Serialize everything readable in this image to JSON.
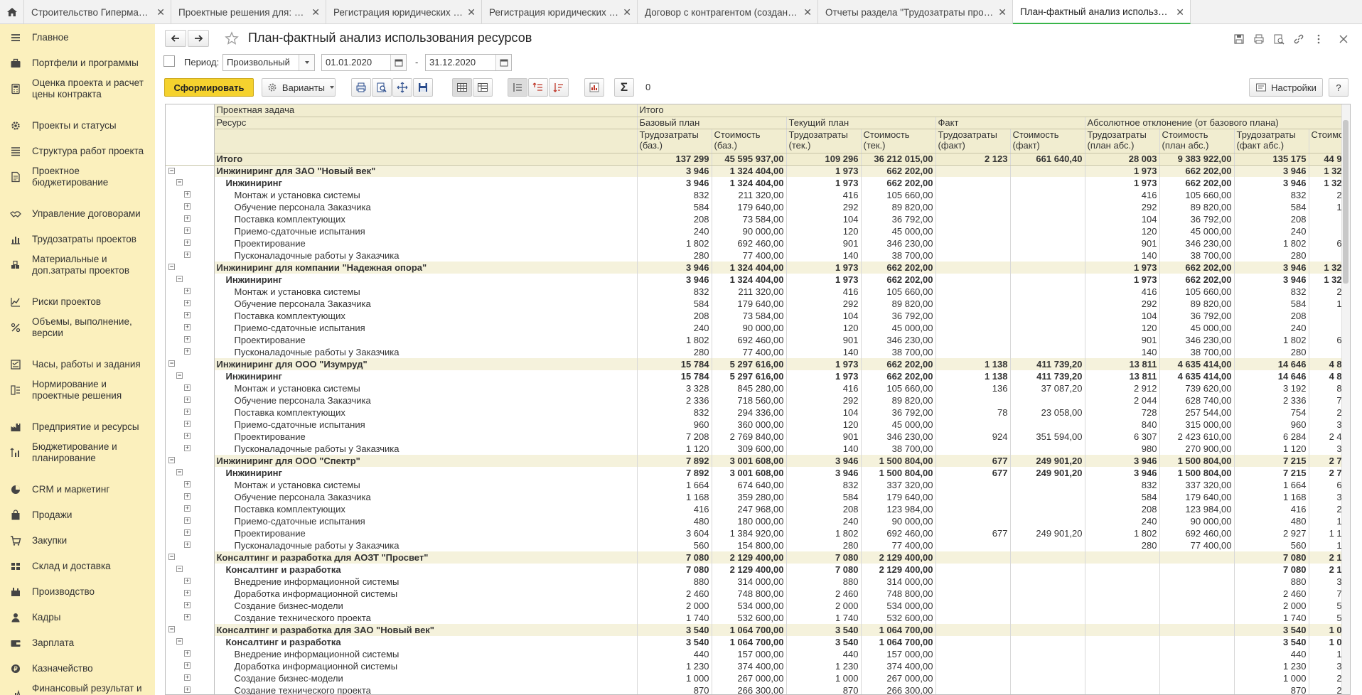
{
  "colors": {
    "sidebar": "#fbf0bd",
    "accent_yellow": "#f5d22e",
    "active_tab": "#39b54a",
    "header_bg": "#f1edd0"
  },
  "tabs": [
    {
      "label": "Строительство Гипермаркета (Проект)",
      "active": false
    },
    {
      "label": "Проектные решения для: Строительство Гипермаркета",
      "active": false
    },
    {
      "label": "Регистрация юридических условий договора",
      "active": false
    },
    {
      "label": "Регистрация юридических условий договора",
      "active": false
    },
    {
      "label": "Договор с контрагентом (создание) *",
      "active": false
    },
    {
      "label": "Отчеты раздела \"Трудозатраты проектов\"",
      "active": false
    },
    {
      "label": "План-фактный анализ использования ресурсов",
      "active": true
    }
  ],
  "sidebar": [
    {
      "label": "Главное",
      "icon": "menu-icon"
    },
    {
      "label": "Портфели и программы",
      "icon": "briefcase-icon"
    },
    {
      "label": "Оценка проекта и расчет цены контракта",
      "icon": "calculator-icon"
    },
    {
      "label": "Проекты и статусы",
      "icon": "gear-icon"
    },
    {
      "label": "Структура работ проекта",
      "icon": "list-icon"
    },
    {
      "label": "Проектное бюджетирование",
      "icon": "document-icon"
    },
    {
      "label": "Управление договорами",
      "icon": "handshake-icon"
    },
    {
      "label": "Трудозатраты проектов",
      "icon": "bar-chart-icon"
    },
    {
      "label": "Материальные и доп.затраты проектов",
      "icon": "boxes-icon"
    },
    {
      "label": "Риски проектов",
      "icon": "graph-icon"
    },
    {
      "label": "Объемы, выполнение, версии",
      "icon": "percent-icon"
    },
    {
      "label": "Часы, работы и задания",
      "icon": "tasks-icon"
    },
    {
      "label": "Нормирование и проектные решения",
      "icon": "norm-icon"
    },
    {
      "label": "Предприятие и ресурсы",
      "icon": "factory-icon"
    },
    {
      "label": "Бюджетирование и планирование",
      "icon": "budget-icon"
    },
    {
      "label": "CRM и маркетинг",
      "icon": "pie-icon"
    },
    {
      "label": "Продажи",
      "icon": "bag-icon"
    },
    {
      "label": "Закупки",
      "icon": "cart-icon"
    },
    {
      "label": "Склад и доставка",
      "icon": "warehouse-icon"
    },
    {
      "label": "Производство",
      "icon": "production-icon"
    },
    {
      "label": "Кадры",
      "icon": "person-icon"
    },
    {
      "label": "Зарплата",
      "icon": "wallet-icon"
    },
    {
      "label": "Казначейство",
      "icon": "coin-icon"
    },
    {
      "label": "Финансовый результат и контроллинг",
      "icon": "finance-icon"
    }
  ],
  "page": {
    "title": "План-фактный анализ использования ресурсов"
  },
  "period": {
    "label": "Период:",
    "type": "Произвольный",
    "from": "01.01.2020",
    "dash": "-",
    "to": "31.12.2020"
  },
  "toolbar": {
    "generate": "Сформировать",
    "variants": "Варианты",
    "sum_value": "0",
    "settings": "Настройки",
    "help": "?"
  },
  "table": {
    "h_task": "Проектная задача",
    "h_res": "Ресурс",
    "h_total": "Итого",
    "h_base": "Базовый план",
    "h_cur": "Текущий план",
    "h_fact": "Факт",
    "h_abs": "Абсолютное отклонение (от базового плана)",
    "col_labels": [
      "Трудозатраты (баз.)",
      "Стоимость (баз.)",
      "Трудозатраты (тек.)",
      "Стоимость (тек.)",
      "Трудозатраты (факт)",
      "Стоимость (факт)",
      "Трудозатраты (план абс.)",
      "Стоимость (план абс.)",
      "Трудозатраты (факт абс.)",
      "Стоимо"
    ],
    "total": {
      "label": "Итого",
      "v": [
        "137 299",
        "45 595 937,00",
        "109 296",
        "36 212 015,00",
        "2 123",
        "661 640,40",
        "28 003",
        "9 383 922,00",
        "135 175",
        "44 9"
      ]
    },
    "rows": [
      {
        "t": "g",
        "l": "Инжиниринг для ЗАО \"Новый век\"",
        "v": [
          "3 946",
          "1 324 404,00",
          "1 973",
          "662 202,00",
          "",
          "",
          "1 973",
          "662 202,00",
          "3 946",
          "1 32"
        ]
      },
      {
        "t": "s",
        "l": "Инжиниринг",
        "v": [
          "3 946",
          "1 324 404,00",
          "1 973",
          "662 202,00",
          "",
          "",
          "1 973",
          "662 202,00",
          "3 946",
          "1 32"
        ]
      },
      {
        "t": "i",
        "l": "Монтаж и установка системы",
        "v": [
          "832",
          "211 320,00",
          "416",
          "105 660,00",
          "",
          "",
          "416",
          "105 660,00",
          "832",
          "2"
        ]
      },
      {
        "t": "i",
        "l": "Обучение персонала Заказчика",
        "v": [
          "584",
          "179 640,00",
          "292",
          "89 820,00",
          "",
          "",
          "292",
          "89 820,00",
          "584",
          "1"
        ]
      },
      {
        "t": "i",
        "l": "Поставка комплектующих",
        "v": [
          "208",
          "73 584,00",
          "104",
          "36 792,00",
          "",
          "",
          "104",
          "36 792,00",
          "208",
          ""
        ]
      },
      {
        "t": "i",
        "l": "Приемо-сдаточные испытания",
        "v": [
          "240",
          "90 000,00",
          "120",
          "45 000,00",
          "",
          "",
          "120",
          "45 000,00",
          "240",
          ""
        ]
      },
      {
        "t": "i",
        "l": "Проектирование",
        "v": [
          "1 802",
          "692 460,00",
          "901",
          "346 230,00",
          "",
          "",
          "901",
          "346 230,00",
          "1 802",
          "6"
        ]
      },
      {
        "t": "i",
        "l": "Пусконаладочные работы у Заказчика",
        "v": [
          "280",
          "77 400,00",
          "140",
          "38 700,00",
          "",
          "",
          "140",
          "38 700,00",
          "280",
          ""
        ]
      },
      {
        "t": "g",
        "l": "Инжиниринг для компании \"Надежная опора\"",
        "v": [
          "3 946",
          "1 324 404,00",
          "1 973",
          "662 202,00",
          "",
          "",
          "1 973",
          "662 202,00",
          "3 946",
          "1 32"
        ]
      },
      {
        "t": "s",
        "l": "Инжиниринг",
        "v": [
          "3 946",
          "1 324 404,00",
          "1 973",
          "662 202,00",
          "",
          "",
          "1 973",
          "662 202,00",
          "3 946",
          "1 32"
        ]
      },
      {
        "t": "i",
        "l": "Монтаж и установка системы",
        "v": [
          "832",
          "211 320,00",
          "416",
          "105 660,00",
          "",
          "",
          "416",
          "105 660,00",
          "832",
          "2"
        ]
      },
      {
        "t": "i",
        "l": "Обучение персонала Заказчика",
        "v": [
          "584",
          "179 640,00",
          "292",
          "89 820,00",
          "",
          "",
          "292",
          "89 820,00",
          "584",
          "1"
        ]
      },
      {
        "t": "i",
        "l": "Поставка комплектующих",
        "v": [
          "208",
          "73 584,00",
          "104",
          "36 792,00",
          "",
          "",
          "104",
          "36 792,00",
          "208",
          ""
        ]
      },
      {
        "t": "i",
        "l": "Приемо-сдаточные испытания",
        "v": [
          "240",
          "90 000,00",
          "120",
          "45 000,00",
          "",
          "",
          "120",
          "45 000,00",
          "240",
          ""
        ]
      },
      {
        "t": "i",
        "l": "Проектирование",
        "v": [
          "1 802",
          "692 460,00",
          "901",
          "346 230,00",
          "",
          "",
          "901",
          "346 230,00",
          "1 802",
          "6"
        ]
      },
      {
        "t": "i",
        "l": "Пусконаладочные работы у Заказчика",
        "v": [
          "280",
          "77 400,00",
          "140",
          "38 700,00",
          "",
          "",
          "140",
          "38 700,00",
          "280",
          ""
        ]
      },
      {
        "t": "g",
        "l": "Инжиниринг для ООО \"Изумруд\"",
        "v": [
          "15 784",
          "5 297 616,00",
          "1 973",
          "662 202,00",
          "1 138",
          "411 739,20",
          "13 811",
          "4 635 414,00",
          "14 646",
          "4 8"
        ]
      },
      {
        "t": "s",
        "l": "Инжиниринг",
        "v": [
          "15 784",
          "5 297 616,00",
          "1 973",
          "662 202,00",
          "1 138",
          "411 739,20",
          "13 811",
          "4 635 414,00",
          "14 646",
          "4 8"
        ]
      },
      {
        "t": "i",
        "l": "Монтаж и установка системы",
        "v": [
          "3 328",
          "845 280,00",
          "416",
          "105 660,00",
          "136",
          "37 087,20",
          "2 912",
          "739 620,00",
          "3 192",
          "8"
        ]
      },
      {
        "t": "i",
        "l": "Обучение персонала Заказчика",
        "v": [
          "2 336",
          "718 560,00",
          "292",
          "89 820,00",
          "",
          "",
          "2 044",
          "628 740,00",
          "2 336",
          "7"
        ]
      },
      {
        "t": "i",
        "l": "Поставка комплектующих",
        "v": [
          "832",
          "294 336,00",
          "104",
          "36 792,00",
          "78",
          "23 058,00",
          "728",
          "257 544,00",
          "754",
          "2"
        ]
      },
      {
        "t": "i",
        "l": "Приемо-сдаточные испытания",
        "v": [
          "960",
          "360 000,00",
          "120",
          "45 000,00",
          "",
          "",
          "840",
          "315 000,00",
          "960",
          "3"
        ]
      },
      {
        "t": "i",
        "l": "Проектирование",
        "v": [
          "7 208",
          "2 769 840,00",
          "901",
          "346 230,00",
          "924",
          "351 594,00",
          "6 307",
          "2 423 610,00",
          "6 284",
          "2 4"
        ]
      },
      {
        "t": "i",
        "l": "Пусконаладочные работы у Заказчика",
        "v": [
          "1 120",
          "309 600,00",
          "140",
          "38 700,00",
          "",
          "",
          "980",
          "270 900,00",
          "1 120",
          "3"
        ]
      },
      {
        "t": "g",
        "l": "Инжиниринг для ООО \"Спектр\"",
        "v": [
          "7 892",
          "3 001 608,00",
          "3 946",
          "1 500 804,00",
          "677",
          "249 901,20",
          "3 946",
          "1 500 804,00",
          "7 215",
          "2 7"
        ]
      },
      {
        "t": "s",
        "l": "Инжиниринг",
        "v": [
          "7 892",
          "3 001 608,00",
          "3 946",
          "1 500 804,00",
          "677",
          "249 901,20",
          "3 946",
          "1 500 804,00",
          "7 215",
          "2 7"
        ]
      },
      {
        "t": "i",
        "l": "Монтаж и установка системы",
        "v": [
          "1 664",
          "674 640,00",
          "832",
          "337 320,00",
          "",
          "",
          "832",
          "337 320,00",
          "1 664",
          "6"
        ]
      },
      {
        "t": "i",
        "l": "Обучение персонала Заказчика",
        "v": [
          "1 168",
          "359 280,00",
          "584",
          "179 640,00",
          "",
          "",
          "584",
          "179 640,00",
          "1 168",
          "3"
        ]
      },
      {
        "t": "i",
        "l": "Поставка комплектующих",
        "v": [
          "416",
          "247 968,00",
          "208",
          "123 984,00",
          "",
          "",
          "208",
          "123 984,00",
          "416",
          "2"
        ]
      },
      {
        "t": "i",
        "l": "Приемо-сдаточные испытания",
        "v": [
          "480",
          "180 000,00",
          "240",
          "90 000,00",
          "",
          "",
          "240",
          "90 000,00",
          "480",
          "1"
        ]
      },
      {
        "t": "i",
        "l": "Проектирование",
        "v": [
          "3 604",
          "1 384 920,00",
          "1 802",
          "692 460,00",
          "677",
          "249 901,20",
          "1 802",
          "692 460,00",
          "2 927",
          "1 1"
        ]
      },
      {
        "t": "i",
        "l": "Пусконаладочные работы у Заказчика",
        "v": [
          "560",
          "154 800,00",
          "280",
          "77 400,00",
          "",
          "",
          "280",
          "77 400,00",
          "560",
          "1"
        ]
      },
      {
        "t": "g",
        "l": "Консалтинг и разработка для АОЗТ \"Просвет\"",
        "v": [
          "7 080",
          "2 129 400,00",
          "7 080",
          "2 129 400,00",
          "",
          "",
          "",
          "",
          "7 080",
          "2 1"
        ]
      },
      {
        "t": "s",
        "l": "Консалтинг и разработка",
        "v": [
          "7 080",
          "2 129 400,00",
          "7 080",
          "2 129 400,00",
          "",
          "",
          "",
          "",
          "7 080",
          "2 1"
        ]
      },
      {
        "t": "i",
        "l": "Внедрение информационной системы",
        "v": [
          "880",
          "314 000,00",
          "880",
          "314 000,00",
          "",
          "",
          "",
          "",
          "880",
          "3"
        ]
      },
      {
        "t": "i",
        "l": "Доработка информационной системы",
        "v": [
          "2 460",
          "748 800,00",
          "2 460",
          "748 800,00",
          "",
          "",
          "",
          "",
          "2 460",
          "7"
        ]
      },
      {
        "t": "i",
        "l": "Создание бизнес-модели",
        "v": [
          "2 000",
          "534 000,00",
          "2 000",
          "534 000,00",
          "",
          "",
          "",
          "",
          "2 000",
          "5"
        ]
      },
      {
        "t": "i",
        "l": "Создание технического проекта",
        "v": [
          "1 740",
          "532 600,00",
          "1 740",
          "532 600,00",
          "",
          "",
          "",
          "",
          "1 740",
          "5"
        ]
      },
      {
        "t": "g",
        "l": "Консалтинг и разработка для ЗАО \"Новый век\"",
        "v": [
          "3 540",
          "1 064 700,00",
          "3 540",
          "1 064 700,00",
          "",
          "",
          "",
          "",
          "3 540",
          "1 0"
        ]
      },
      {
        "t": "s",
        "l": "Консалтинг и разработка",
        "v": [
          "3 540",
          "1 064 700,00",
          "3 540",
          "1 064 700,00",
          "",
          "",
          "",
          "",
          "3 540",
          "1 0"
        ]
      },
      {
        "t": "i",
        "l": "Внедрение информационной системы",
        "v": [
          "440",
          "157 000,00",
          "440",
          "157 000,00",
          "",
          "",
          "",
          "",
          "440",
          "1"
        ]
      },
      {
        "t": "i",
        "l": "Доработка информационной системы",
        "v": [
          "1 230",
          "374 400,00",
          "1 230",
          "374 400,00",
          "",
          "",
          "",
          "",
          "1 230",
          "3"
        ]
      },
      {
        "t": "i",
        "l": "Создание бизнес-модели",
        "v": [
          "1 000",
          "267 000,00",
          "1 000",
          "267 000,00",
          "",
          "",
          "",
          "",
          "1 000",
          "2"
        ]
      },
      {
        "t": "i",
        "l": "Создание технического проекта",
        "v": [
          "870",
          "266 300,00",
          "870",
          "266 300,00",
          "",
          "",
          "",
          "",
          "870",
          "2"
        ]
      }
    ]
  }
}
